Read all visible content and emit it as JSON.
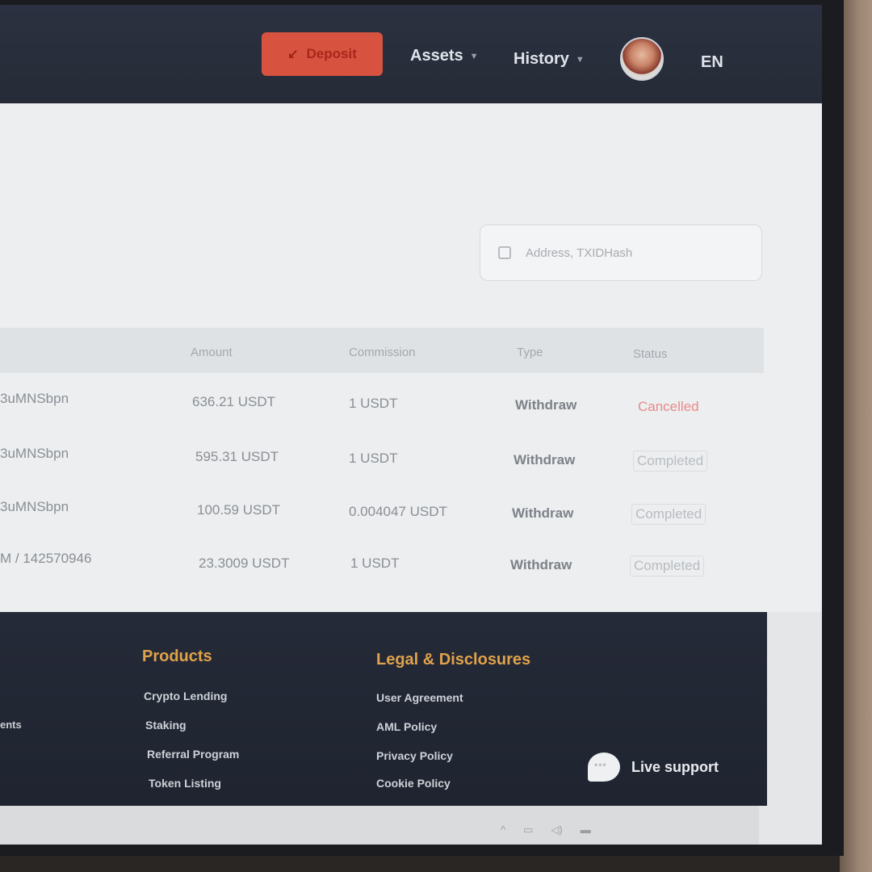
{
  "nav": {
    "deposit_label": "Deposit",
    "assets_label": "Assets",
    "history_label": "History",
    "language": "EN"
  },
  "search": {
    "placeholder": "Address, TXIDHash"
  },
  "table": {
    "headers": [
      "Amount",
      "Commission",
      "Type",
      "Status"
    ],
    "rows": [
      {
        "address": "3uMNSbpn",
        "amount": "636.21 USDT",
        "commission": "1 USDT",
        "type": "Withdraw",
        "status": "Cancelled"
      },
      {
        "address": "3uMNSbpn",
        "amount": "595.31 USDT",
        "commission": "1 USDT",
        "type": "Withdraw",
        "status": "Completed"
      },
      {
        "address": "3uMNSbpn",
        "amount": "100.59 USDT",
        "commission": "0.004047 USDT",
        "type": "Withdraw",
        "status": "Completed"
      },
      {
        "address": "M / 142570946",
        "amount": "23.3009 USDT",
        "commission": "1 USDT",
        "type": "Withdraw",
        "status": "Completed"
      }
    ]
  },
  "footer": {
    "left_text": "ents",
    "products": {
      "heading": "Products",
      "links": [
        "Crypto Lending",
        "Staking",
        "Referral Program",
        "Token Listing"
      ]
    },
    "legal": {
      "heading": "Legal & Disclosures",
      "links": [
        "User Agreement",
        "AML Policy",
        "Privacy Policy",
        "Cookie Policy"
      ]
    },
    "live_support": "Live support"
  },
  "colors": {
    "topbar": "#2b3140",
    "deposit": "#d85240",
    "footer_heading": "#e0a24a",
    "status_cancelled": "#e98a8a"
  },
  "icons": [
    "arrow-icon",
    "chevron-down-icon",
    "avatar",
    "search-checkbox-icon",
    "chat-bubble-icon"
  ]
}
